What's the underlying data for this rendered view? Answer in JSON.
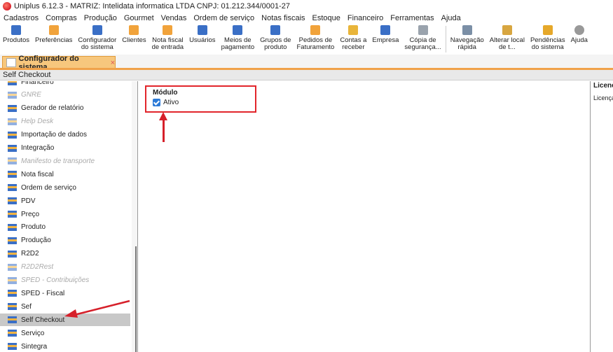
{
  "window": {
    "title": "Uniplus 6.12.3 - MATRIZ: Intelidata informatica LTDA CNPJ: 01.212.344/0001-27"
  },
  "menu": [
    "Cadastros",
    "Compras",
    "Produção",
    "Gourmet",
    "Vendas",
    "Ordem de serviço",
    "Notas fiscais",
    "Estoque",
    "Financeiro",
    "Ferramentas",
    "Ajuda"
  ],
  "toolbar": [
    {
      "label1": "Produtos",
      "label2": "",
      "icon": "box-icon",
      "color": "#3a6fc6"
    },
    {
      "label1": "Preferências",
      "label2": "",
      "icon": "preferences-icon",
      "color": "#f1a33b"
    },
    {
      "label1": "Configurador",
      "label2": "do sistema",
      "icon": "config-icon",
      "color": "#3a6fc6"
    },
    {
      "label1": "Clientes",
      "label2": "",
      "icon": "client-icon",
      "color": "#f1a33b"
    },
    {
      "label1": "Nota fiscal",
      "label2": "de entrada",
      "icon": "invoice-icon",
      "color": "#f1a33b"
    },
    {
      "label1": "Usuários",
      "label2": "",
      "icon": "users-icon",
      "color": "#3a6fc6"
    },
    {
      "label1": "Meios de",
      "label2": "pagamento",
      "icon": "payment-icon",
      "color": "#3a6fc6"
    },
    {
      "label1": "Grupos de",
      "label2": "produto",
      "icon": "group-icon",
      "color": "#3a6fc6"
    },
    {
      "label1": "Pedidos de",
      "label2": "Faturamento",
      "icon": "orders-icon",
      "color": "#f1a33b"
    },
    {
      "label1": "Contas a",
      "label2": "receber",
      "icon": "coins-icon",
      "color": "#e9b53a"
    },
    {
      "label1": "Empresa",
      "label2": "",
      "icon": "company-icon",
      "color": "#3a6fc6"
    },
    {
      "label1": "Cópia de",
      "label2": "segurança...",
      "icon": "backup-icon",
      "color": "#9aa3ad"
    },
    {
      "label1": "Navegação",
      "label2": "rápida",
      "icon": "navigation-icon",
      "color": "#7b8fa6"
    },
    {
      "label1": "Alterar local",
      "label2": "de t...",
      "icon": "home-icon",
      "color": "#d8a640"
    },
    {
      "label1": "Pendências",
      "label2": "do sistema",
      "icon": "warning-icon",
      "color": "#e6a82a"
    },
    {
      "label1": "Ajuda",
      "label2": "",
      "icon": "help-icon",
      "color": "#999999"
    }
  ],
  "tab": {
    "label": "Configurador do sistema",
    "close": "×"
  },
  "subtitle": "Self Checkout",
  "sidebar": [
    {
      "label": "Financeiro",
      "dim": false
    },
    {
      "label": "GNRE",
      "dim": true
    },
    {
      "label": "Gerador de relatório",
      "dim": false
    },
    {
      "label": "Help Desk",
      "dim": true
    },
    {
      "label": "Importação de dados",
      "dim": false
    },
    {
      "label": "Integração",
      "dim": false
    },
    {
      "label": "Manifesto de transporte",
      "dim": true
    },
    {
      "label": "Nota fiscal",
      "dim": false
    },
    {
      "label": "Ordem de serviço",
      "dim": false
    },
    {
      "label": "PDV",
      "dim": false
    },
    {
      "label": "Preço",
      "dim": false
    },
    {
      "label": "Produto",
      "dim": false
    },
    {
      "label": "Produção",
      "dim": false
    },
    {
      "label": "R2D2",
      "dim": false
    },
    {
      "label": "R2D2Rest",
      "dim": true
    },
    {
      "label": "SPED - Contribuições",
      "dim": true
    },
    {
      "label": "SPED - Fiscal",
      "dim": false
    },
    {
      "label": "Sef",
      "dim": false
    },
    {
      "label": "Self Checkout",
      "dim": false,
      "selected": true
    },
    {
      "label": "Serviço",
      "dim": false
    },
    {
      "label": "Sintegra",
      "dim": false
    }
  ],
  "module": {
    "title": "Módulo",
    "checkbox_label": "Ativo",
    "checked": true
  },
  "right_panel": {
    "header": "Licença",
    "label": "Licença"
  },
  "colors": {
    "accent": "#f0a24a",
    "highlight": "#e2252b",
    "selected_row": "#c8c8c8"
  }
}
